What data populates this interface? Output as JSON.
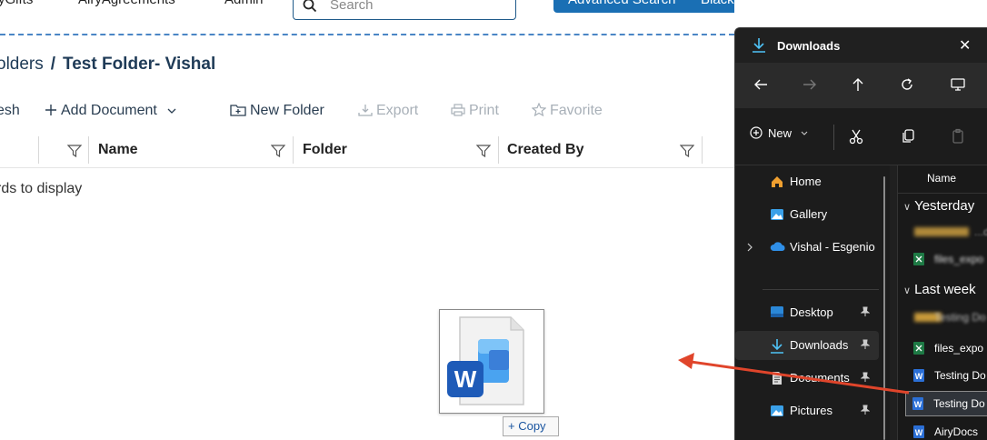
{
  "topnav": {
    "items": [
      "yGifts",
      "AiryAgreements",
      "Admin"
    ],
    "search_placeholder": "Search",
    "advanced_search_label": "Advanced Search",
    "tenant_label": "Blackbaud-New"
  },
  "breadcrumb": {
    "parent": "olders",
    "separator": "/",
    "current": "Test Folder- Vishal"
  },
  "toolbar": {
    "refresh": "esh",
    "add_document": "Add Document",
    "new_folder": "New Folder",
    "export": "Export",
    "print": "Print",
    "favorite": "Favorite"
  },
  "grid": {
    "columns": [
      "Name",
      "Folder",
      "Created By"
    ],
    "empty_message": "rds to display"
  },
  "drag": {
    "copy_label": "+ Copy"
  },
  "explorer": {
    "title": "Downloads",
    "new_label": "New",
    "sidebar": [
      {
        "label": "Home",
        "icon": "home-icon"
      },
      {
        "label": "Gallery",
        "icon": "gallery-icon"
      },
      {
        "label": "Vishal - Esgenio",
        "icon": "onedrive-cloud-icon"
      },
      {
        "label": "Desktop",
        "icon": "desktop-folder-icon",
        "pinned": true
      },
      {
        "label": "Downloads",
        "icon": "download-icon",
        "pinned": true,
        "selected": true
      },
      {
        "label": "Documents",
        "icon": "documents-folder-icon",
        "pinned": true
      },
      {
        "label": "Pictures",
        "icon": "pictures-folder-icon",
        "pinned": true
      }
    ],
    "column_header": "Name",
    "groups": {
      "yesterday": "Yesterday",
      "last_week": "Last week"
    },
    "files": {
      "yesterday_1": "...do",
      "yesterday_2": "files_expo",
      "lastweek_1": "Testing Do",
      "lastweek_2": "files_expo",
      "lastweek_3": "Testing Do",
      "lastweek_4": "Testing Do",
      "lastweek_5": "AiryDocs"
    }
  },
  "colors": {
    "accent": "#1a6fb4",
    "dashed_border": "#4a86c5",
    "arrow": "#e0452b",
    "explorer_bg": "#202020"
  }
}
